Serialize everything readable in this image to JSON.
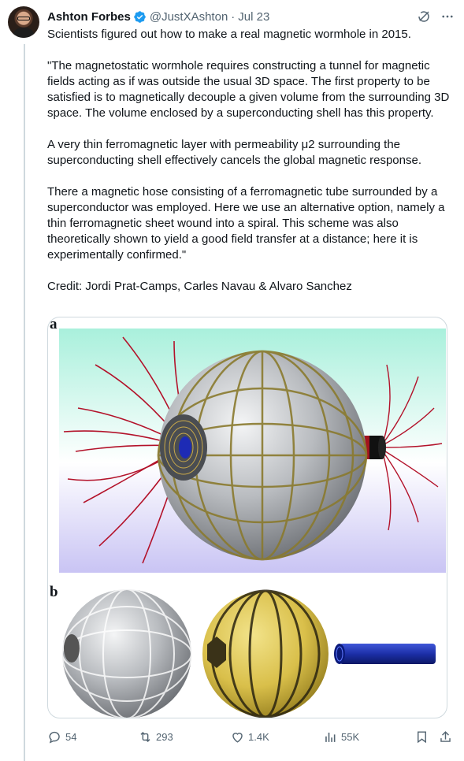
{
  "author": {
    "name": "Ashton Forbes",
    "handle": "@JustXAshton",
    "separator": "·",
    "date": "Jul 23"
  },
  "tweet": {
    "text": "Scientists figured out how to make a real magnetic wormhole in 2015.\n\n\"The magnetostatic wormhole requires constructing a tunnel for magnetic fields acting as if was outside the usual 3D space. The first property to be satisfied is to magnetically decouple a given volume from the surrounding 3D space. The volume enclosed by a superconducting shell has this property.\n\nA very thin ferromagnetic layer with permeability μ2 surrounding the superconducting shell effectively cancels the global magnetic response.\n\nThere a magnetic hose consisting of a ferromagnetic tube surrounded by a superconductor was employed. Here we use an alternative option, namely a thin ferromagnetic sheet wound into a spiral. This scheme was also theoretically shown to yield a good field transfer at a distance; here it is experimentally confirmed.\"\n\nCredit: Jordi Prat-Camps, Carles Navau & Alvaro Sanchez"
  },
  "media": {
    "panel_a_label": "a",
    "panel_b_label": "b",
    "colors": {
      "sky_top": "#a9f0dc",
      "sky_bottom": "#c9c4f4",
      "field_lines": "#b3122a",
      "metal": "#b9bcc0",
      "gold": "#d9bf4a",
      "tube_blue": "#1c2fa8"
    }
  },
  "actions": {
    "replies": "54",
    "retweets": "293",
    "likes": "1.4K",
    "views": "55K"
  },
  "icons": [
    "verified-badge-icon",
    "grok-icon",
    "more-icon",
    "reply-icon",
    "retweet-icon",
    "like-icon",
    "views-icon",
    "bookmark-icon",
    "share-icon"
  ]
}
